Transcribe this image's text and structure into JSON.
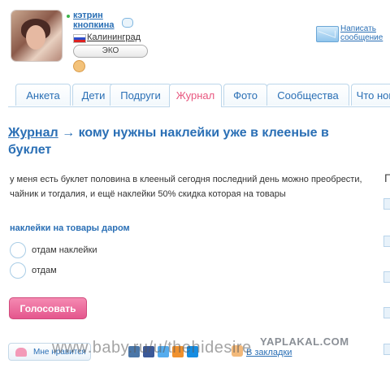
{
  "profile": {
    "name": "кэтрин кнопкина",
    "city": "Калининград",
    "badge": "ЭКО"
  },
  "header": {
    "write_message": [
      "Написать",
      "сообщение"
    ]
  },
  "tabs": [
    "Анкета",
    "Дети",
    "Подруги",
    "Журнал",
    "Фото",
    "Сообщества",
    "Что нов"
  ],
  "active_tab": "Журнал",
  "post": {
    "section_link": "Журнал",
    "arrow": "→",
    "title": "кому нужны наклейки уже в клееные в буклет",
    "text": "у меня есть буклет половина в клееный сегодня последний день можно преобрести, чайник и тогдалия, и ещё наклейки 50% скидка которая на товары"
  },
  "poll": {
    "question": "наклейки на товары даром",
    "options": [
      "отдам наклейки",
      "отдам"
    ],
    "vote_label": "Голосовать"
  },
  "sidebar": {
    "title_partial": "П"
  },
  "footer": {
    "like_label": "Мне нравится",
    "bookmarks_label": "В закладки"
  },
  "watermarks": {
    "site": "www.baby.ru/u/thehidesire",
    "yaplakal": "YAPLAKAL.COM"
  },
  "colors": {
    "link": "#2a6fb5",
    "accent_pink": "#e4568d"
  }
}
